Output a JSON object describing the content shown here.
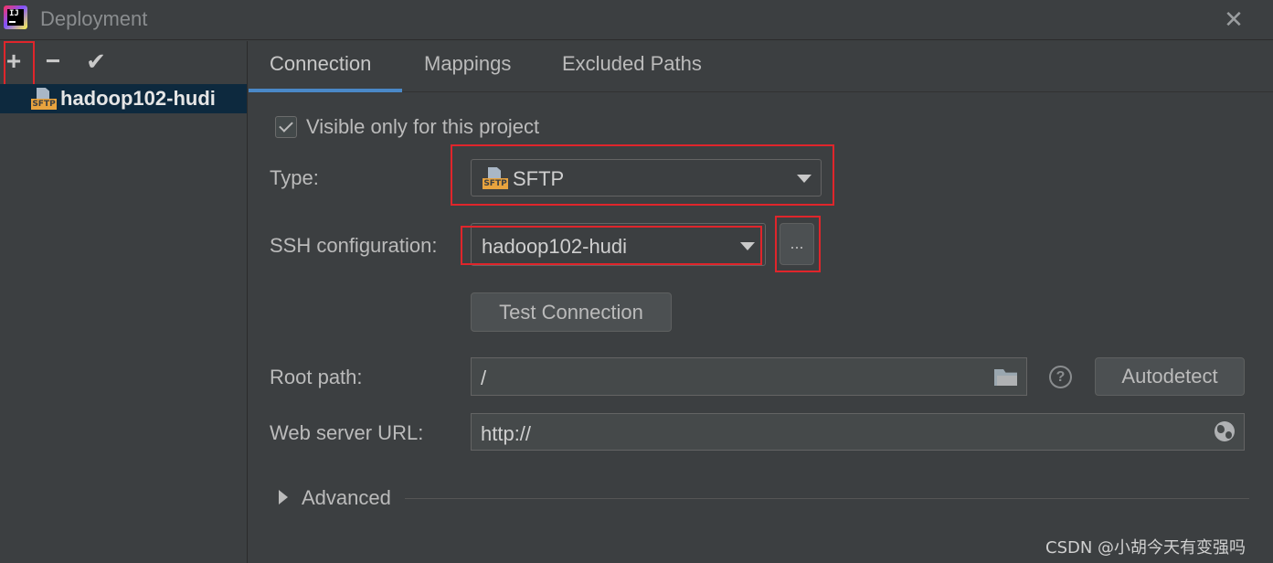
{
  "window": {
    "title": "Deployment",
    "app_icon_text": "IJ"
  },
  "toolbar": {
    "add_label": "+",
    "remove_label": "−",
    "apply_label": "✔"
  },
  "server_list": {
    "items": [
      {
        "label": "hadoop102-hudi",
        "icon": "sftp-icon",
        "icon_tag": "SFTP",
        "selected": true
      }
    ]
  },
  "tabs": [
    {
      "label": "Connection",
      "active": true
    },
    {
      "label": "Mappings",
      "active": false
    },
    {
      "label": "Excluded Paths",
      "active": false
    }
  ],
  "form": {
    "visible_only": {
      "label": "Visible only for this project",
      "checked": true
    },
    "type": {
      "label": "Type:",
      "value": "SFTP",
      "icon_tag": "SFTP"
    },
    "ssh": {
      "label": "SSH configuration:",
      "value": "hadoop102-hudi",
      "browse_label": "..."
    },
    "test_connection_label": "Test Connection",
    "root_path": {
      "label": "Root path:",
      "value": "/"
    },
    "autodetect_label": "Autodetect",
    "help_label": "?",
    "web_server_url": {
      "label": "Web server URL:",
      "value": "http://"
    },
    "advanced_label": "Advanced"
  },
  "watermark": "CSDN @小胡今天有变强吗",
  "colors": {
    "background": "#3c3f41",
    "selection": "#0d293e",
    "tab_accent": "#4a88c7",
    "highlight_red": "#e0252b",
    "sftp_tag": "#e8a33e"
  }
}
